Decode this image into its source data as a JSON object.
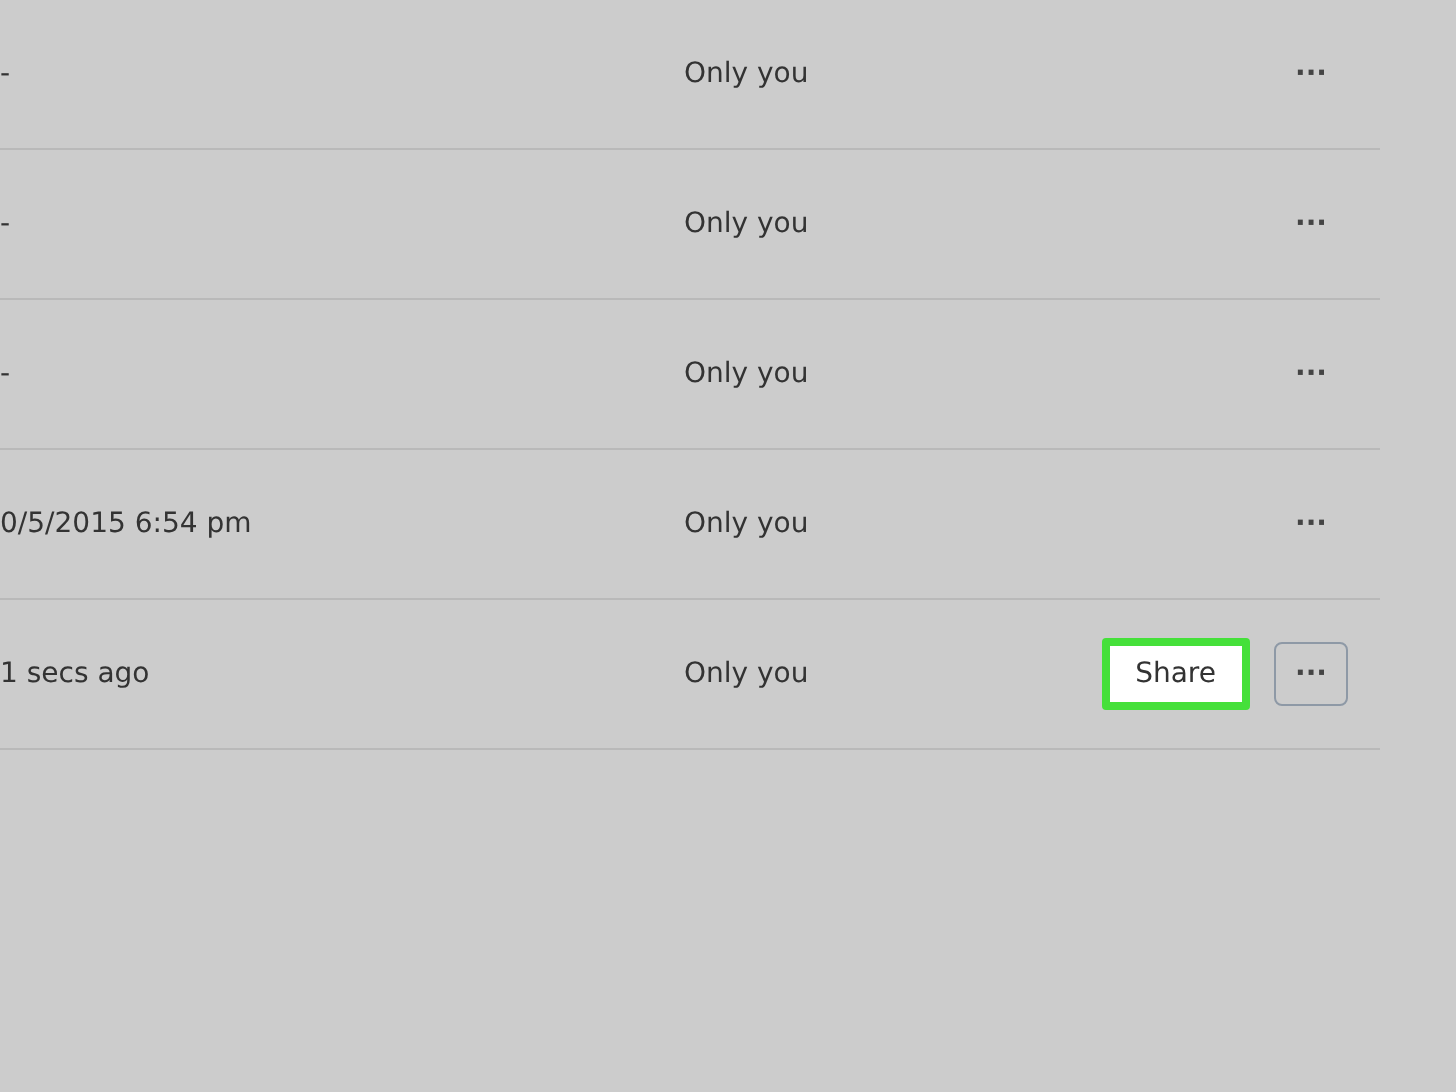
{
  "files": [
    {
      "modified": "-",
      "members": "Only you",
      "more": "···",
      "hovered": false
    },
    {
      "modified": "-",
      "members": "Only you",
      "more": "···",
      "hovered": false
    },
    {
      "modified": "-",
      "members": "Only you",
      "more": "···",
      "hovered": false
    },
    {
      "modified": "0/5/2015 6:54 pm",
      "members": "Only you",
      "more": "···",
      "hovered": false
    },
    {
      "modified": "1 secs ago",
      "members": "Only you",
      "more": "···",
      "hovered": true,
      "share": {
        "label": "Share",
        "highlighted": true
      }
    }
  ]
}
